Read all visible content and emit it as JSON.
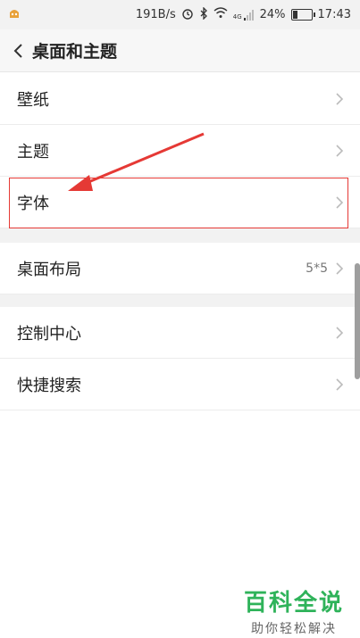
{
  "status_bar": {
    "network_speed": "191B/s",
    "battery": "24%",
    "battery_level": 0.24,
    "time": "17:43",
    "signal_badge": "4G"
  },
  "header": {
    "title": "桌面和主题"
  },
  "settings": {
    "items": [
      {
        "label": "壁纸",
        "value": ""
      },
      {
        "label": "主题",
        "value": ""
      },
      {
        "label": "字体",
        "value": ""
      },
      {
        "label": "桌面布局",
        "value": "5*5"
      },
      {
        "label": "控制中心",
        "value": ""
      },
      {
        "label": "快捷搜索",
        "value": ""
      }
    ]
  },
  "watermark": {
    "title": "百科全说",
    "subtitle": "助你轻松解决"
  },
  "colors": {
    "highlight": "#e53935",
    "watermark_green": "#2fb35a"
  }
}
